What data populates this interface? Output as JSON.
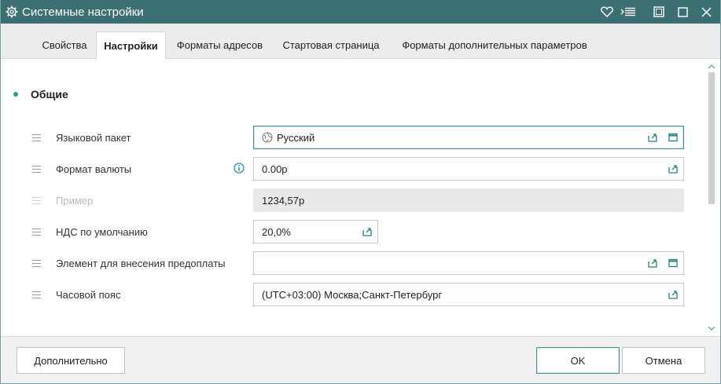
{
  "window": {
    "title": "Системные настройки",
    "icon": "gear-icon",
    "controls": [
      "heart-icon",
      "menu-list-icon",
      "restore-icon",
      "maximize-icon",
      "close-icon"
    ]
  },
  "tabs": [
    {
      "label": "Свойства",
      "active": false
    },
    {
      "label": "Настройки",
      "active": true
    },
    {
      "label": "Форматы адресов",
      "active": false
    },
    {
      "label": "Стартовая страница",
      "active": false
    },
    {
      "label": "Форматы дополнительных параметров",
      "active": false
    }
  ],
  "section": {
    "title": "Общие"
  },
  "fields": {
    "language": {
      "label": "Языковой пакет",
      "value": "Русский",
      "icon": "globe-icon"
    },
    "currency": {
      "label": "Формат валюты",
      "value": "0.00р",
      "info_icon": "info-icon"
    },
    "example": {
      "label": "Пример",
      "value": "1234,57р"
    },
    "vat": {
      "label": "НДС по умолчанию",
      "value": "20,0%"
    },
    "prepayment": {
      "label": "Элемент для внесения предоплаты",
      "value": ""
    },
    "timezone": {
      "label": "Часовой пояс",
      "value": "(UTC+03:00) Москва;Санкт-Петербург"
    }
  },
  "footer": {
    "more_label": "Дополнительно",
    "ok_label": "OK",
    "cancel_label": "Отмена"
  },
  "colors": {
    "titlebar": "#3b6f73",
    "accent": "#2a9d8f",
    "focus_border": "#4a8f9a",
    "info": "#1e8fd1"
  }
}
